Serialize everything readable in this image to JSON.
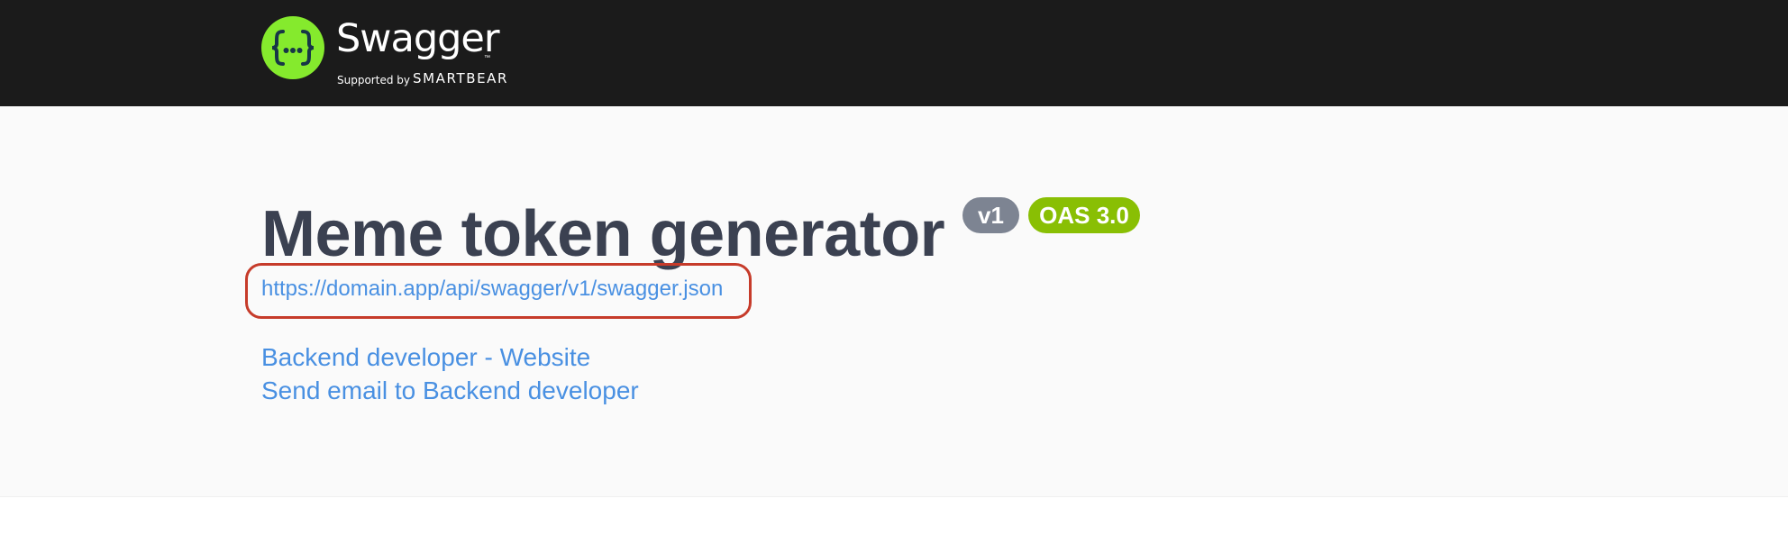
{
  "header": {
    "logo": {
      "icon": "swagger-braces-icon",
      "icon_glyph": "{···}",
      "brand": "Swagger",
      "trademark": "™",
      "supported_by": "Supported by",
      "company": "SMARTBEAR"
    },
    "background_color": "#1b1b1b",
    "logo_color": "#85ea2d"
  },
  "info": {
    "title": "Meme token generator",
    "version_badge": "v1",
    "oas_badge": "OAS 3.0",
    "spec_url": "https://domain.app/api/swagger/v1/swagger.json",
    "contact_website": "Backend developer - Website",
    "contact_email": "Send email to Backend developer"
  },
  "colors": {
    "title": "#3b4151",
    "link": "#4990e2",
    "version_badge": "#7d8492",
    "oas_badge": "#89bf04",
    "highlight": "#c63b2a"
  }
}
